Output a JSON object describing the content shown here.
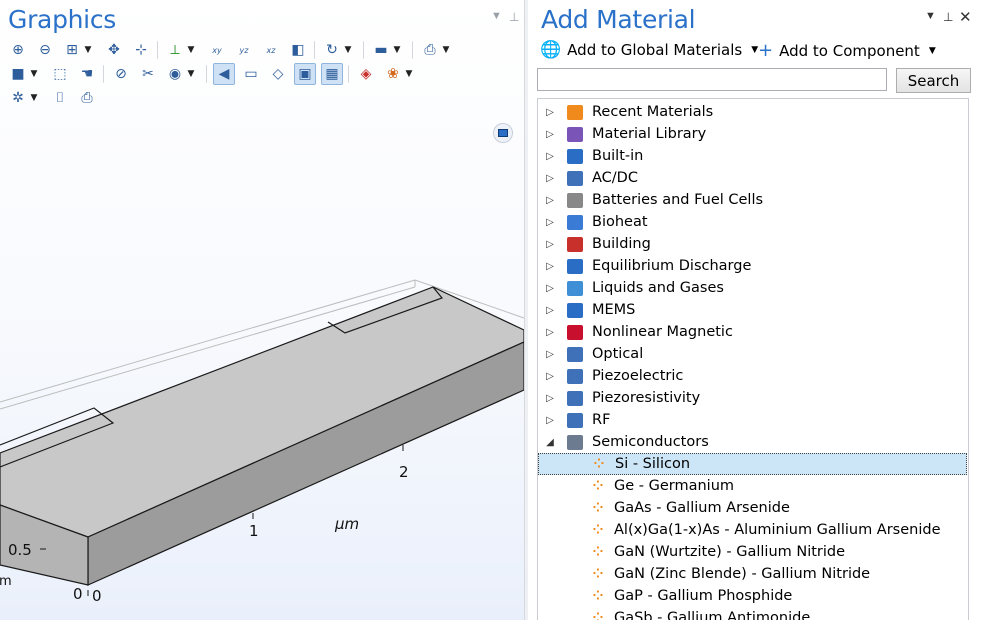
{
  "graphics": {
    "title": "Graphics",
    "axis": {
      "unit": "μm",
      "x_ticks": [
        "1",
        "2"
      ],
      "y_ticks": [
        "0.5",
        "0"
      ],
      "z_ticks": [
        "0"
      ],
      "cut_label": "m"
    }
  },
  "add_material": {
    "title": "Add Material",
    "add_global_label": "Add to Global Materials",
    "add_component_label": "Add to Component",
    "search_value": "",
    "search_label": "Search",
    "tree": [
      {
        "label": "Recent Materials",
        "icon": "recent-materials-icon",
        "color": "#f08a1c"
      },
      {
        "label": "Material Library",
        "icon": "library-icon",
        "color": "#7b54b8"
      },
      {
        "label": "Built-in",
        "icon": "builtin-icon",
        "color": "#2a6dc4"
      },
      {
        "label": "AC/DC",
        "icon": "acdc-icon",
        "color": "#3e71b8"
      },
      {
        "label": "Batteries and Fuel Cells",
        "icon": "battery-icon",
        "color": "#888888"
      },
      {
        "label": "Bioheat",
        "icon": "bioheat-icon",
        "color": "#3a7bd5"
      },
      {
        "label": "Building",
        "icon": "building-icon",
        "color": "#c8302c"
      },
      {
        "label": "Equilibrium Discharge",
        "icon": "discharge-icon",
        "color": "#2a6dc4"
      },
      {
        "label": "Liquids and Gases",
        "icon": "liquids-icon",
        "color": "#3e8fd6"
      },
      {
        "label": "MEMS",
        "icon": "mems-icon",
        "color": "#2a6dc4"
      },
      {
        "label": "Nonlinear Magnetic",
        "icon": "magnet-icon",
        "color": "#c8102e"
      },
      {
        "label": "Optical",
        "icon": "optical-icon",
        "color": "#3e71b8"
      },
      {
        "label": "Piezoelectric",
        "icon": "piezoelectric-icon",
        "color": "#3e71b8"
      },
      {
        "label": "Piezoresistivity",
        "icon": "piezoresistivity-icon",
        "color": "#3e71b8"
      },
      {
        "label": "RF",
        "icon": "rf-icon",
        "color": "#3e71b8"
      },
      {
        "label": "Semiconductors",
        "icon": "semiconductor-icon",
        "color": "#6c7b8f",
        "expanded": true
      }
    ],
    "semiconductor_materials": [
      {
        "label": "Si - Silicon",
        "selected": true
      },
      {
        "label": "Ge - Germanium"
      },
      {
        "label": "GaAs - Gallium Arsenide"
      },
      {
        "label": "Al(x)Ga(1-x)As - Aluminium Gallium Arsenide"
      },
      {
        "label": "GaN (Wurtzite) - Gallium Nitride"
      },
      {
        "label": "GaN (Zinc Blende) - Gallium Nitride"
      },
      {
        "label": "GaP - Gallium Phosphide"
      },
      {
        "label": "GaSb - Gallium Antimonide"
      }
    ]
  }
}
